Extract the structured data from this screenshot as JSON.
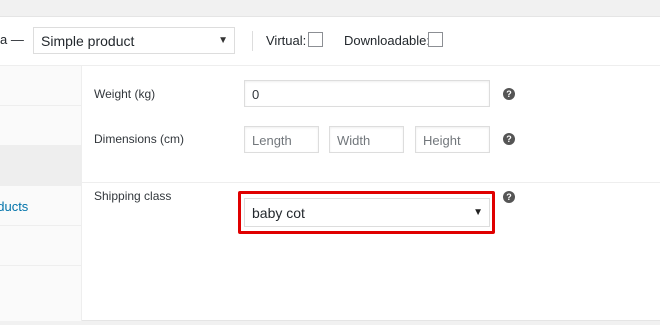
{
  "header": {
    "prefix_text": "a —",
    "product_type": "Simple product",
    "virtual_label": "Virtual:",
    "downloadable_label": "Downloadable:"
  },
  "sidebar": {
    "items": [
      {
        "label": ""
      },
      {
        "label": ""
      },
      {
        "label": ""
      },
      {
        "label": "oducts"
      },
      {
        "label": ""
      },
      {
        "label": ""
      }
    ]
  },
  "shipping": {
    "weight_label": "Weight (kg)",
    "weight_value": "0",
    "dimensions_label": "Dimensions (cm)",
    "length_placeholder": "Length",
    "width_placeholder": "Width",
    "height_placeholder": "Height",
    "shipping_class_label": "Shipping class",
    "shipping_class_value": "baby cot",
    "help_glyph": "?"
  },
  "colors": {
    "highlight": "#e00000",
    "link": "#0073aa"
  }
}
